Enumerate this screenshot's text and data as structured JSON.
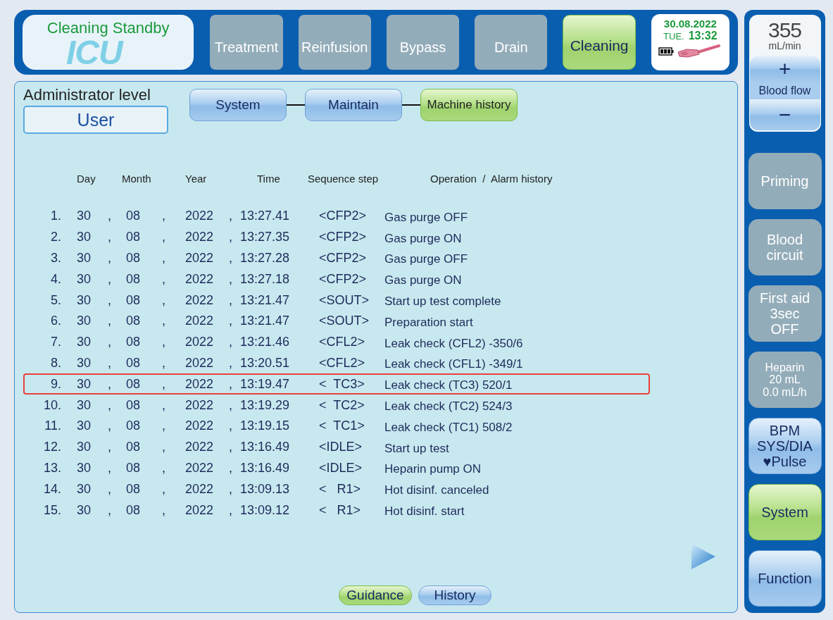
{
  "status": {
    "text": "Cleaning Standby",
    "background_label": "ICU"
  },
  "mode_tabs": [
    {
      "label": "Treatment",
      "disabled": true,
      "selected": false
    },
    {
      "label": "Reinfusion",
      "disabled": true,
      "selected": false
    },
    {
      "label": "Bypass",
      "disabled": true,
      "selected": false
    },
    {
      "label": "Drain",
      "disabled": true,
      "selected": false
    },
    {
      "label": "Cleaning",
      "disabled": false,
      "selected": true
    }
  ],
  "clock": {
    "date": "30.08.2022",
    "weekday": "TUE.",
    "time": "13:32"
  },
  "access": {
    "title": "Administrator level",
    "value": "User"
  },
  "nav": [
    {
      "label": "System",
      "selected": false
    },
    {
      "label": "Maintain",
      "selected": false
    },
    {
      "label": "Machine history",
      "selected": true
    }
  ],
  "table": {
    "columns": [
      "Day",
      "Month",
      "Year",
      "Time",
      "Sequence step",
      "Operation  /  Alarm history"
    ],
    "rows": [
      {
        "index": "1.",
        "day": "30",
        "month": "08",
        "year": "2022",
        "sep": [
          ",",
          ",",
          ","
        ],
        "time": "13:27.41",
        "step": "<CFP2>",
        "operation": "Gas purge OFF",
        "highlighted": false
      },
      {
        "index": "2.",
        "day": "30",
        "month": "08",
        "year": "2022",
        "sep": [
          ",",
          ",",
          ","
        ],
        "time": "13:27.35",
        "step": "<CFP2>",
        "operation": "Gas purge ON",
        "highlighted": false
      },
      {
        "index": "3.",
        "day": "30",
        "month": "08",
        "year": "2022",
        "sep": [
          ",",
          ",",
          ","
        ],
        "time": "13:27.28",
        "step": "<CFP2>",
        "operation": "Gas purge OFF",
        "highlighted": false
      },
      {
        "index": "4.",
        "day": "30",
        "month": "08",
        "year": "2022",
        "sep": [
          ",",
          ",",
          ","
        ],
        "time": "13:27.18",
        "step": "<CFP2>",
        "operation": "Gas purge ON",
        "highlighted": false
      },
      {
        "index": "5.",
        "day": "30",
        "month": "08",
        "year": "2022",
        "sep": [
          ",",
          ",",
          ","
        ],
        "time": "13:21.47",
        "step": "<SOUT>",
        "operation": "Start up test complete",
        "highlighted": false
      },
      {
        "index": "6.",
        "day": "30",
        "month": "08",
        "year": "2022",
        "sep": [
          ",",
          ",",
          ","
        ],
        "time": "13:21.47",
        "step": "<SOUT>",
        "operation": "Preparation start",
        "highlighted": false
      },
      {
        "index": "7.",
        "day": "30",
        "month": "08",
        "year": "2022",
        "sep": [
          ",",
          ",",
          ","
        ],
        "time": "13:21.46",
        "step": "<CFL2>",
        "operation": "Leak check (CFL2) -350/6",
        "highlighted": false
      },
      {
        "index": "8.",
        "day": "30",
        "month": "08",
        "year": "2022",
        "sep": [
          ",",
          ",",
          ","
        ],
        "time": "13:20.51",
        "step": "<CFL2>",
        "operation": "Leak check (CFL1) -349/1",
        "highlighted": false
      },
      {
        "index": "9.",
        "day": "30",
        "month": "08",
        "year": "2022",
        "sep": [
          ",",
          ",",
          ","
        ],
        "time": "13:19.47",
        "step": "<  TC3>",
        "operation": "Leak check (TC3) 520/1",
        "highlighted": true
      },
      {
        "index": "10.",
        "day": "30",
        "month": "08",
        "year": "2022",
        "sep": [
          ",",
          ",",
          ","
        ],
        "time": "13:19.29",
        "step": "<  TC2>",
        "operation": "Leak check (TC2) 524/3",
        "highlighted": false
      },
      {
        "index": "11.",
        "day": "30",
        "month": "08",
        "year": "2022",
        "sep": [
          ",",
          ",",
          ","
        ],
        "time": "13:19.15",
        "step": "<  TC1>",
        "operation": "Leak check (TC1) 508/2",
        "highlighted": false
      },
      {
        "index": "12.",
        "day": "30",
        "month": "08",
        "year": "2022",
        "sep": [
          ",",
          ",",
          ","
        ],
        "time": "13:16.49",
        "step": "<IDLE>",
        "operation": "Start up test",
        "highlighted": false
      },
      {
        "index": "13.",
        "day": "30",
        "month": "08",
        "year": "2022",
        "sep": [
          ",",
          ",",
          ","
        ],
        "time": "13:16.49",
        "step": "<IDLE>",
        "operation": "Heparin pump ON",
        "highlighted": false
      },
      {
        "index": "14.",
        "day": "30",
        "month": "08",
        "year": "2022",
        "sep": [
          ",",
          ",",
          ","
        ],
        "time": "13:09.13",
        "step": "<   R1>",
        "operation": "Hot disinf. canceled",
        "highlighted": false
      },
      {
        "index": "15.",
        "day": "30",
        "month": "08",
        "year": "2022",
        "sep": [
          ",",
          ",",
          ","
        ],
        "time": "13:09.12",
        "step": "<   R1>",
        "operation": "Hot disinf. start",
        "highlighted": false
      }
    ]
  },
  "bottom_buttons": [
    {
      "label": "Guidance",
      "selected": true
    },
    {
      "label": "History",
      "selected": false
    }
  ],
  "blood_flow": {
    "value": "355",
    "unit": "mL/min",
    "increase": "+",
    "label": "Blood flow",
    "decrease": "−"
  },
  "side_buttons": [
    {
      "lines": [
        "Priming"
      ],
      "disabled": true,
      "selected": false,
      "kind": "large"
    },
    {
      "lines": [
        "Blood",
        "circuit"
      ],
      "disabled": true,
      "selected": false,
      "kind": "large"
    },
    {
      "lines": [
        "First aid",
        "3sec",
        "OFF"
      ],
      "disabled": true,
      "selected": false,
      "kind": "large"
    },
    {
      "lines": [
        "Heparin",
        "20 mL",
        "0.0 mL/h"
      ],
      "disabled": true,
      "selected": false,
      "kind": "small"
    },
    {
      "lines": [
        "BPM",
        "SYS/DIA",
        "♥Pulse"
      ],
      "disabled": false,
      "selected": false,
      "kind": "large"
    },
    {
      "lines": [
        "System"
      ],
      "disabled": false,
      "selected": true,
      "kind": "large"
    },
    {
      "lines": [
        "Function"
      ],
      "disabled": false,
      "selected": false,
      "kind": "large"
    }
  ]
}
